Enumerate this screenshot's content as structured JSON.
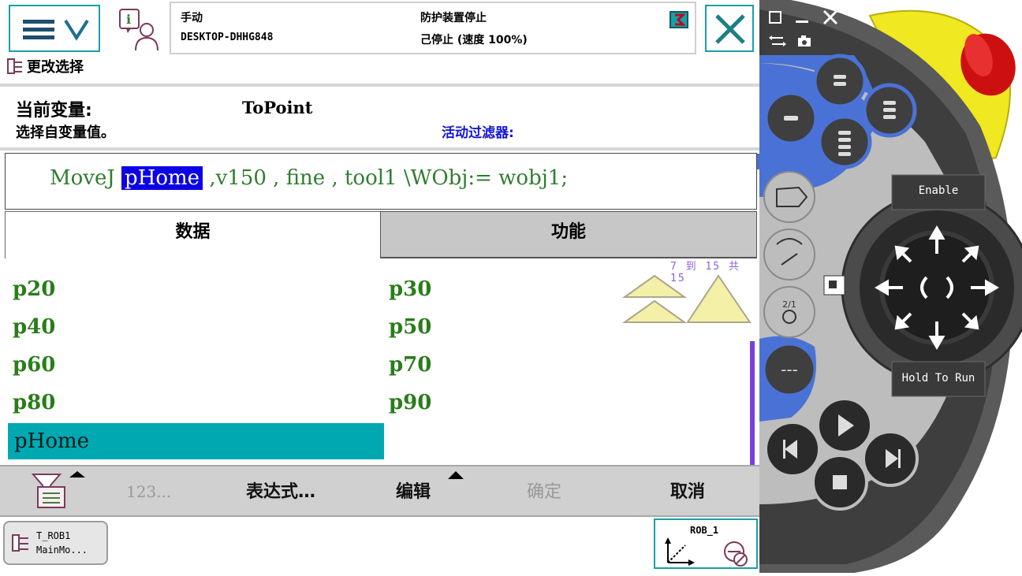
{
  "window_controls": {
    "restore_icon": "restore-icon",
    "minimize_icon": "minimize-icon",
    "close_icon": "close-icon",
    "swap_icon": "swap-icon",
    "camera_icon": "camera-icon"
  },
  "header": {
    "menu_icon": "hamburger-menu-icon",
    "info_icon": "event-log-icon",
    "mode": "手动",
    "controller": "DESKTOP-DHHG848",
    "safety_status": "防护装置停止",
    "run_status": "己停止 (速度 100%)",
    "close_label": "close"
  },
  "breadcrumb": {
    "label": "更改选择"
  },
  "info": {
    "current_var_label": "当前变量:",
    "current_var_value": "ToPoint",
    "instruction": "选择自变量值。",
    "filter_label": "活动过滤器:"
  },
  "code": {
    "prefix": "MoveJ ",
    "selected": "pHome",
    "suffix": " ,v150 , fine , tool1 \\WObj:= wobj1;"
  },
  "tabs": [
    {
      "label": "数据",
      "active": true
    },
    {
      "label": "功能",
      "active": false
    }
  ],
  "page_indicator": "7 到 15 共 15",
  "list": {
    "left": [
      "p20",
      "p40",
      "p60",
      "p80",
      "pHome"
    ],
    "right": [
      "p30",
      "p50",
      "p70",
      "p90"
    ],
    "selected": "pHome"
  },
  "bottom_bar": {
    "filter_icon": "filter-icon",
    "num": "123...",
    "expression": "表达式…",
    "edit": "编辑",
    "ok": "确定",
    "cancel": "取消"
  },
  "taskbar": {
    "task_line1": "T_ROB1",
    "task_line2": "MainMo...",
    "robot": "ROB_1"
  },
  "pendant": {
    "enable": "Enable",
    "hold_to_run": "Hold To Run"
  },
  "colors": {
    "accent": "#1b9fa6",
    "selection": "#00a9b1",
    "code_highlight": "#0b00e6",
    "list_text": "#2a7d1a",
    "pendant_blue": "#4a72d6"
  }
}
